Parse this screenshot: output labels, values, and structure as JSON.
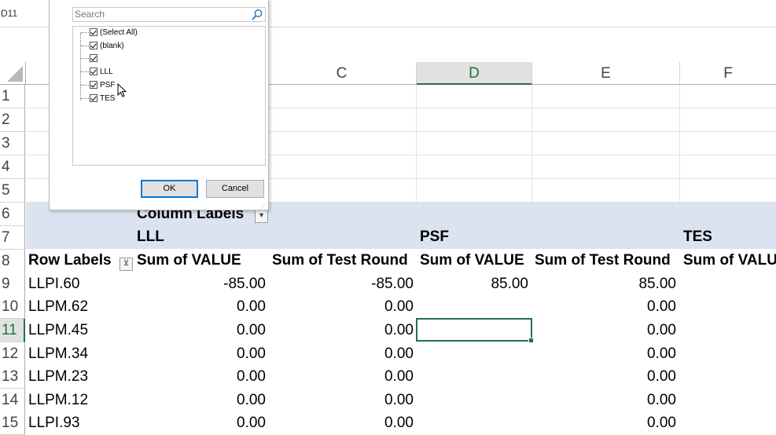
{
  "formula_bar": {
    "name_box": "D11"
  },
  "columns": [
    "C",
    "D",
    "E",
    "F"
  ],
  "selected_column": "D",
  "rows": [
    "1",
    "2",
    "3",
    "4",
    "5",
    "6",
    "7",
    "8",
    "9",
    "10",
    "11",
    "12",
    "13",
    "14",
    "15"
  ],
  "selected_row": "11",
  "pivot": {
    "column_labels": "Column Labels",
    "row_labels": "Row Labels",
    "groups": [
      "LLL",
      "PSF",
      "TES"
    ],
    "headers": [
      "Sum of VALUE",
      "Sum of Test Round",
      "Sum of VALUE",
      "Sum of Test Round",
      "Sum of VALU"
    ],
    "data_rows": [
      {
        "label": "LLPI.60",
        "v1": "-85.00",
        "v2": "-85.00",
        "v3": "85.00",
        "v4": "85.00"
      },
      {
        "label": "LLPM.62",
        "v1": "0.00",
        "v2": "0.00",
        "v3": "",
        "v4": "0.00"
      },
      {
        "label": "LLPM.45",
        "v1": "0.00",
        "v2": "0.00",
        "v3": "",
        "v4": "0.00"
      },
      {
        "label": "LLPM.34",
        "v1": "0.00",
        "v2": "0.00",
        "v3": "",
        "v4": "0.00"
      },
      {
        "label": "LLPM.23",
        "v1": "0.00",
        "v2": "0.00",
        "v3": "",
        "v4": "0.00"
      },
      {
        "label": "LLPM.12",
        "v1": "0.00",
        "v2": "0.00",
        "v3": "",
        "v4": "0.00"
      },
      {
        "label": "LLPI.93",
        "v1": "0.00",
        "v2": "0.00",
        "v3": "",
        "v4": "0.00"
      }
    ]
  },
  "filter_popup": {
    "search_placeholder": "Search",
    "items": [
      "(Select All)",
      "(blank)",
      "",
      "LLL",
      "PSF",
      "TES"
    ],
    "ok_label": "OK",
    "cancel_label": "Cancel"
  },
  "colors": {
    "accent": "#217346",
    "pivot_band": "#dbe3f1",
    "selection_header": "#e1e1e1"
  }
}
